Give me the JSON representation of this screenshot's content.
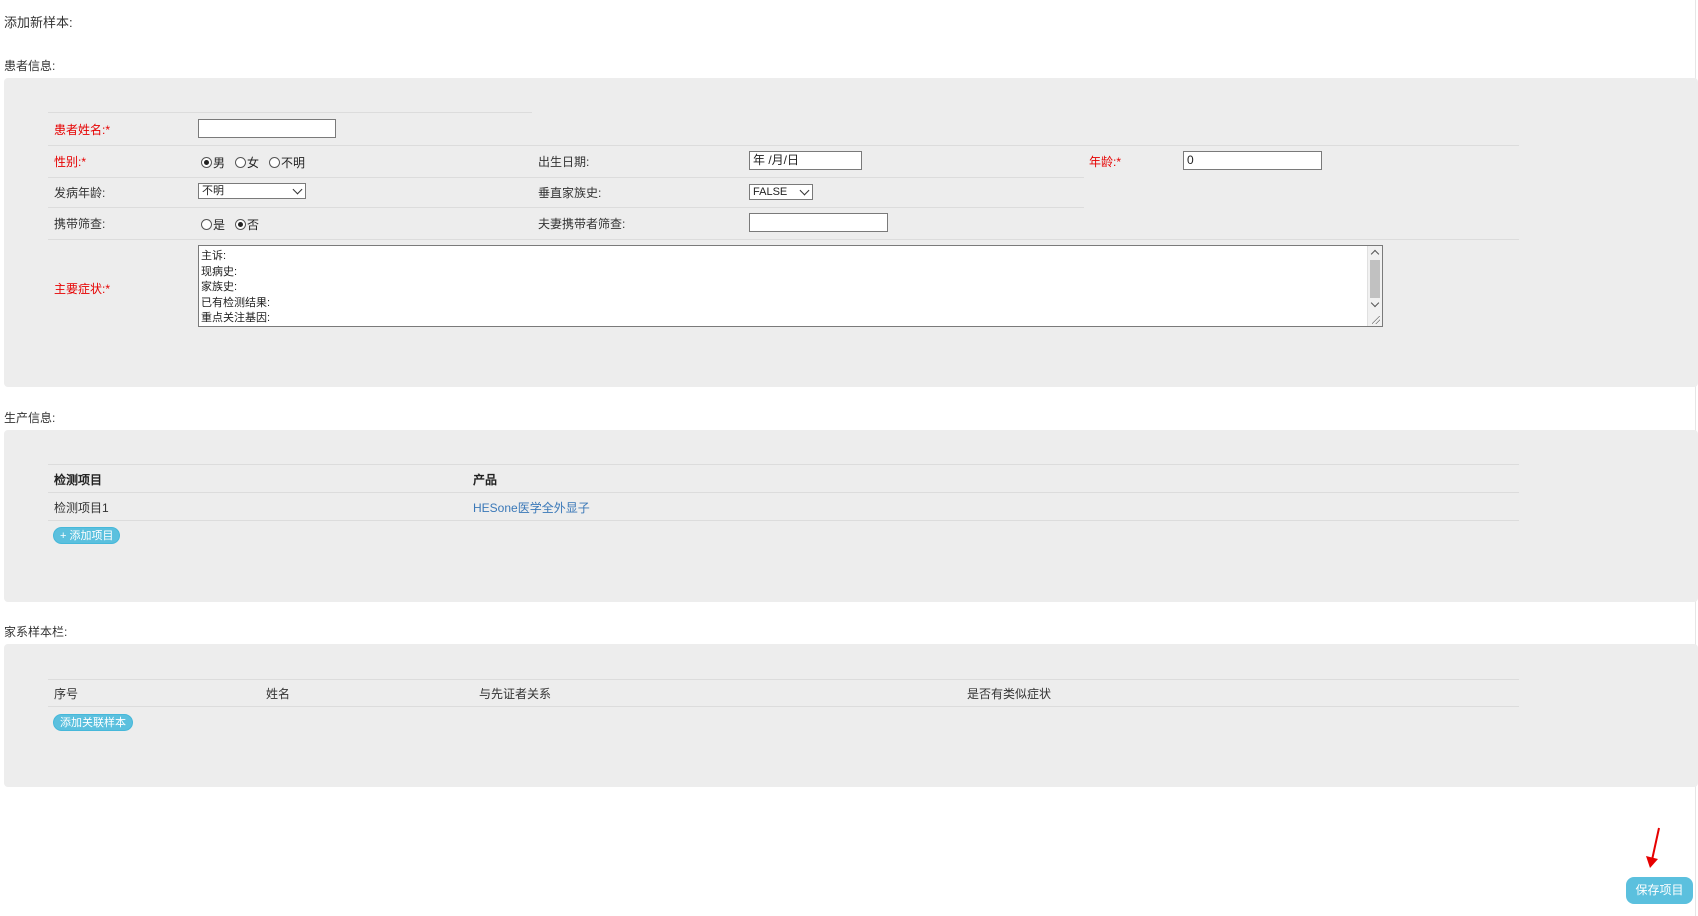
{
  "page_title": "添加新样本:",
  "patient_section": {
    "title": "患者信息:",
    "name_label": "患者姓名:",
    "name_value": "",
    "gender_label": "性别:",
    "gender_options": [
      "男",
      "女",
      "不明"
    ],
    "gender_selected": "男",
    "birth_label": "出生日期:",
    "birth_placeholder": "年 /月/日",
    "age_label": "年龄:",
    "age_value": "0",
    "onset_label": "发病年龄:",
    "onset_value": "不明",
    "vertical_label": "垂直家族史:",
    "vertical_value": "FALSE",
    "carrier_label": "携带筛查:",
    "carrier_options": [
      "是",
      "否"
    ],
    "carrier_selected": "否",
    "spouse_label": "夫妻携带者筛查:",
    "spouse_value": "",
    "symptom_label": "主要症状:",
    "required_mark": "*",
    "symptom_lines": [
      "主诉:",
      "现病史:",
      "家族史:",
      "已有检测结果:",
      "重点关注基因:"
    ]
  },
  "production_section": {
    "title": "生产信息:",
    "columns": [
      "检测项目",
      "产品"
    ],
    "rows": [
      {
        "item": "检测项目1",
        "product": "HESone医学全外显子"
      }
    ],
    "add_button": "+ 添加项目"
  },
  "family_section": {
    "title": "家系样本栏:",
    "columns": [
      "序号",
      "姓名",
      "与先证者关系",
      "是否有类似症状"
    ],
    "add_button": "添加关联样本"
  },
  "save_button": "保存项目",
  "colors": {
    "panel_bg": "#ededed",
    "required_red": "#e60000",
    "button_blue": "#5bc0de",
    "link_blue": "#3a78b8",
    "annotation_arrow": "#e60000"
  }
}
